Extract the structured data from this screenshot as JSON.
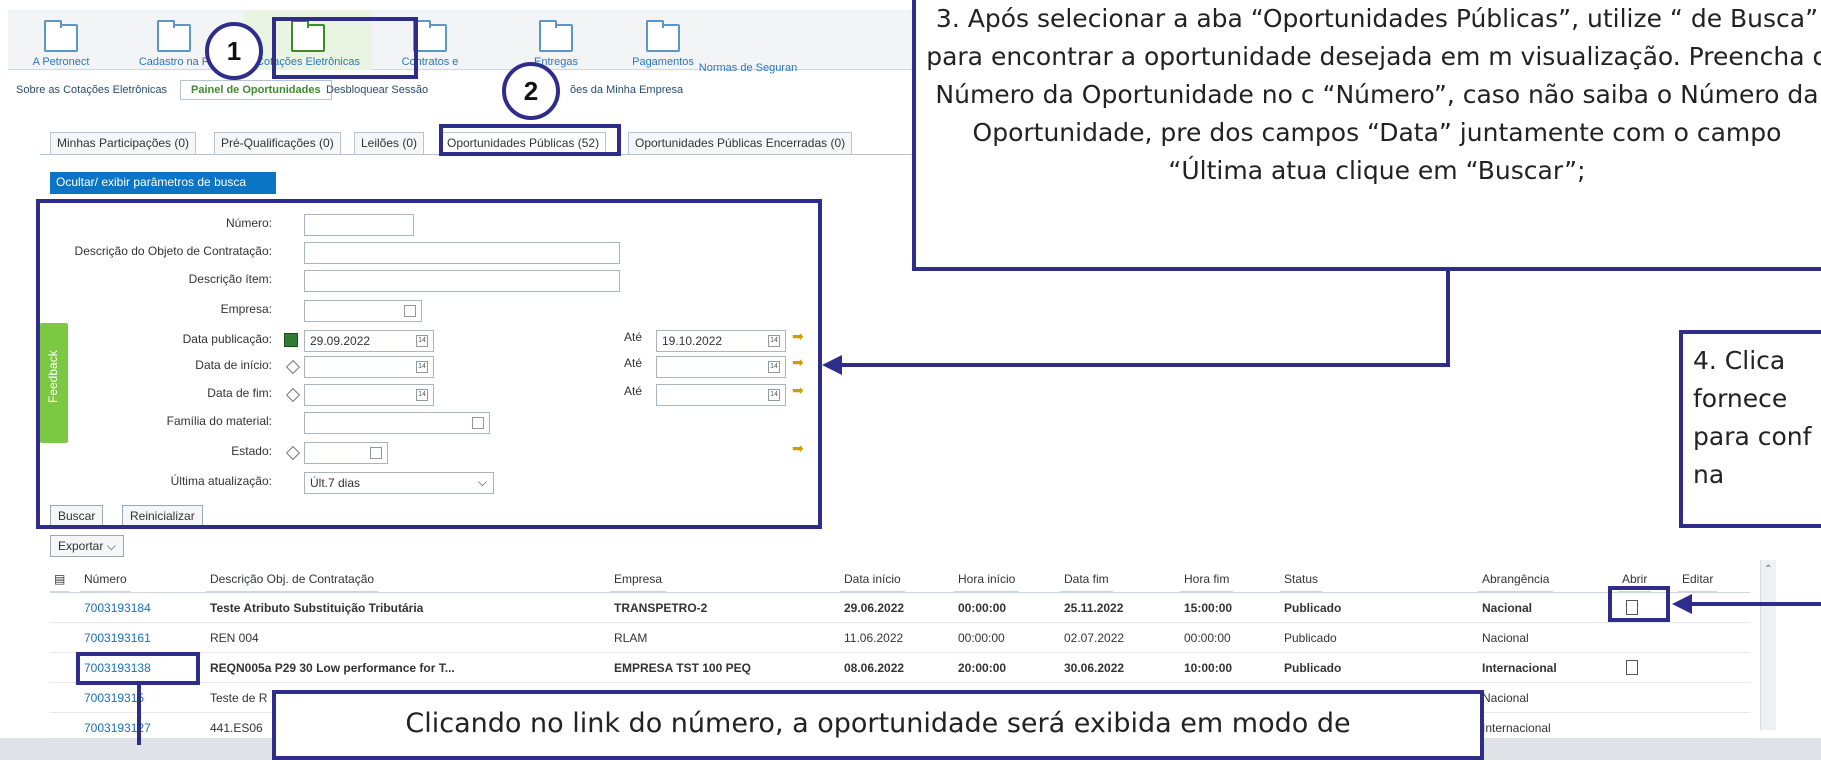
{
  "nav": {
    "items": [
      {
        "label": "A Petronect"
      },
      {
        "label": "Cadastro na P"
      },
      {
        "label": "Cotações Eletrônicas"
      },
      {
        "label": "Contratos e"
      },
      {
        "label": "Entregas"
      },
      {
        "label": "Pagamentos"
      },
      {
        "label": "Normas de Seguran"
      }
    ]
  },
  "subnav": {
    "items": [
      "Sobre as Cotações Eletrônicas",
      "Painel de Oportunidades",
      "Desbloquear Sessão",
      "ões da Minha Empresa"
    ]
  },
  "tabs": {
    "minhas": "Minhas Participações (0)",
    "pre": "Pré-Qualificações (0)",
    "leiloes": "Leilões (0)",
    "publicas": "Oportunidades Públicas (52)",
    "encerradas": "Oportunidades Públicas Encerradas (0)"
  },
  "search": {
    "toggle": "Ocultar/ exibir parâmetros de busca",
    "numero": "Número:",
    "descricao_objeto": "Descrição do Objeto de Contratação:",
    "descricao_item": "Descrição ítem:",
    "empresa": "Empresa:",
    "data_publicacao": "Data publicação:",
    "data_inicio": "Data de início:",
    "data_fim": "Data de fim:",
    "familia": "Família do material:",
    "estado": "Estado:",
    "ultima": "Última atualização:",
    "ate": "Até",
    "pub_from": "29.09.2022",
    "pub_to": "19.10.2022",
    "ultima_value": "Últ.7 dias",
    "buscar": "Buscar",
    "reinicializar": "Reinicializar",
    "feedback": "Feedback"
  },
  "table": {
    "exportar": "Exportar",
    "headers": [
      "Número",
      "Descrição Obj. de Contratação",
      "Empresa",
      "Data início",
      "Hora início",
      "Data fim",
      "Hora fim",
      "Status",
      "Abrangência",
      "Abrir",
      "Editar"
    ],
    "rows": [
      {
        "numero": "7003193184",
        "descricao": "Teste Atributo Substituição Tributária",
        "empresa": "TRANSPETRO-2",
        "data_inicio": "29.06.2022",
        "hora_inicio": "00:00:00",
        "data_fim": "25.11.2022",
        "hora_fim": "15:00:00",
        "status": "Publicado",
        "abrangencia": "Nacional"
      },
      {
        "numero": "7003193161",
        "descricao": "REN 004",
        "empresa": "RLAM",
        "data_inicio": "11.06.2022",
        "hora_inicio": "00:00:00",
        "data_fim": "02.07.2022",
        "hora_fim": "00:00:00",
        "status": "Publicado",
        "abrangencia": "Nacional"
      },
      {
        "numero": "7003193138",
        "descricao": "REQN005a P29 30 Low performance for T...",
        "empresa": "EMPRESA TST 100 PEQ",
        "data_inicio": "08.06.2022",
        "hora_inicio": "20:00:00",
        "data_fim": "30.06.2022",
        "hora_fim": "10:00:00",
        "status": "Publicado",
        "abrangencia": "Internacional"
      },
      {
        "numero": "700319315",
        "descricao": "Teste de R",
        "abrangencia": "Nacional"
      },
      {
        "numero": "7003193127",
        "descricao": "441.ES06",
        "abrangencia": "Internacional"
      }
    ]
  },
  "callouts": {
    "c3": "3. Após selecionar a aba “Oportunidades Públicas”, utilize “ de Busca” para encontrar a oportunidade desejada em m visualização. Preencha o Número da Oportunidade no c “Número”, caso não saiba o Número da Oportunidade, pre dos campos “Data” juntamente com o campo “Última atua clique em “Buscar”;",
    "c4": "4. Clica fornece para conf na",
    "bottom": "Clicando no link do número, a oportunidade será exibida em modo de"
  },
  "numbers": {
    "one": "1",
    "two": "2"
  }
}
